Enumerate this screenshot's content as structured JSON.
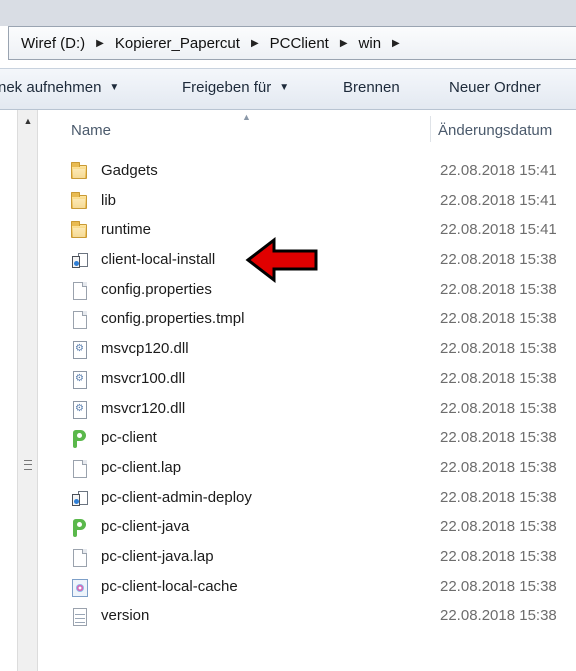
{
  "breadcrumb": {
    "items": [
      {
        "label": "Wiref (D:)"
      },
      {
        "label": "Kopierer_Papercut"
      },
      {
        "label": "PCClient"
      },
      {
        "label": "win"
      }
    ]
  },
  "toolbar": {
    "include_label": "nek aufnehmen",
    "share_label": "Freigeben für",
    "burn_label": "Brennen",
    "new_folder_label": "Neuer Ordner"
  },
  "columns": {
    "name": "Name",
    "date": "Änderungsdatum"
  },
  "files": [
    {
      "name": "Gadgets",
      "date": "22.08.2018 15:41",
      "icon": "folder-icon"
    },
    {
      "name": "lib",
      "date": "22.08.2018 15:41",
      "icon": "folder-icon"
    },
    {
      "name": "runtime",
      "date": "22.08.2018 15:41",
      "icon": "folder-icon"
    },
    {
      "name": "client-local-install",
      "date": "22.08.2018 15:38",
      "icon": "batch-file-icon"
    },
    {
      "name": "config.properties",
      "date": "22.08.2018 15:38",
      "icon": "document-icon"
    },
    {
      "name": "config.properties.tmpl",
      "date": "22.08.2018 15:38",
      "icon": "document-icon"
    },
    {
      "name": "msvcp120.dll",
      "date": "22.08.2018 15:38",
      "icon": "dll-icon"
    },
    {
      "name": "msvcr100.dll",
      "date": "22.08.2018 15:38",
      "icon": "dll-icon"
    },
    {
      "name": "msvcr120.dll",
      "date": "22.08.2018 15:38",
      "icon": "dll-icon"
    },
    {
      "name": "pc-client",
      "date": "22.08.2018 15:38",
      "icon": "papercut-app-icon"
    },
    {
      "name": "pc-client.lap",
      "date": "22.08.2018 15:38",
      "icon": "document-icon"
    },
    {
      "name": "pc-client-admin-deploy",
      "date": "22.08.2018 15:38",
      "icon": "batch-file-icon"
    },
    {
      "name": "pc-client-java",
      "date": "22.08.2018 15:38",
      "icon": "papercut-app-icon"
    },
    {
      "name": "pc-client-java.lap",
      "date": "22.08.2018 15:38",
      "icon": "document-icon"
    },
    {
      "name": "pc-client-local-cache",
      "date": "22.08.2018 15:38",
      "icon": "url-shortcut-icon"
    },
    {
      "name": "version",
      "date": "22.08.2018 15:38",
      "icon": "text-file-icon"
    }
  ],
  "annotation": {
    "icon": "red-arrow-icon",
    "color": "#e00000"
  }
}
